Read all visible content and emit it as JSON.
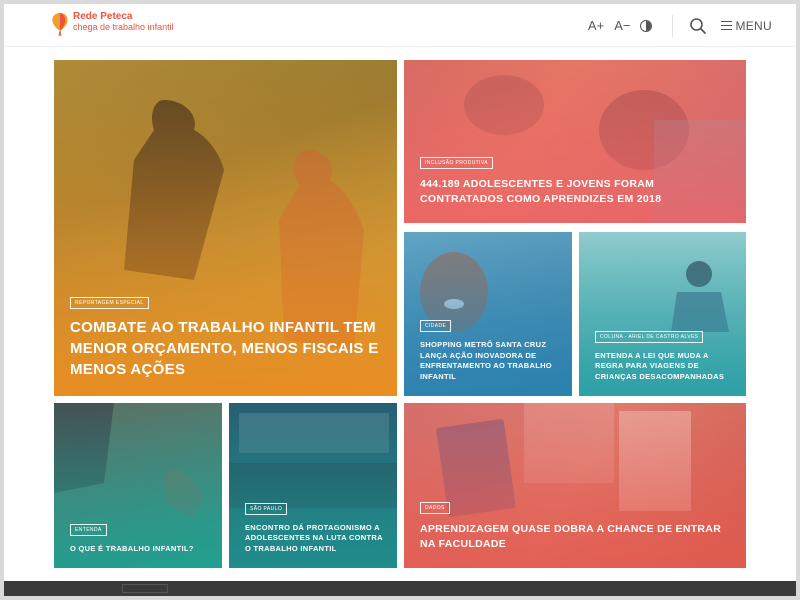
{
  "header": {
    "brand_name": "Rede Peteca",
    "tagline": "chega de trabalho infantil",
    "font_increase": "A+",
    "font_decrease": "A−",
    "menu_label": "MENU",
    "brand_color": "#e8553c"
  },
  "cards": {
    "main": {
      "tag": "REPORTAGEM ESPECIAL",
      "title": "COMBATE AO TRABALHO INFANTIL TEM MENOR ORÇAMENTO, MENOS FISCAIS E MENOS AÇÕES"
    },
    "top_right": {
      "tag": "INCLUSÃO PRODUTIVA",
      "title": "444.189 ADOLESCENTES E JOVENS FORAM CONTRATADOS COMO APRENDIZES EM 2018"
    },
    "mid_left": {
      "tag": "CIDADE",
      "title": "SHOPPING METRÔ SANTA CRUZ LANÇA AÇÃO INOVADORA DE ENFRENTAMENTO AO TRABALHO INFANTIL"
    },
    "mid_right": {
      "tag": "COLUNA - ARIEL DE CASTRO ALVES",
      "title": "ENTENDA A LEI QUE MUDA A REGRA PARA VIAGENS DE CRIANÇAS DESACOMPANHADAS"
    },
    "bottom_1": {
      "tag": "ENTENDA",
      "title": "O QUE É TRABALHO INFANTIL?"
    },
    "bottom_2": {
      "tag": "SÃO PAULO",
      "title": "ENCONTRO DÁ PROTAGONISMO A ADOLESCENTES NA LUTA CONTRA O TRABALHO INFANTIL"
    },
    "bottom_3": {
      "tag": "DADOS",
      "title": "APRENDIZAGEM QUASE DOBRA A CHANCE DE ENTRAR NA FACULDADE"
    }
  },
  "icons": {
    "logo": "balloon-logo-icon",
    "contrast": "contrast-icon",
    "search": "search-icon",
    "menu": "hamburger-icon"
  }
}
